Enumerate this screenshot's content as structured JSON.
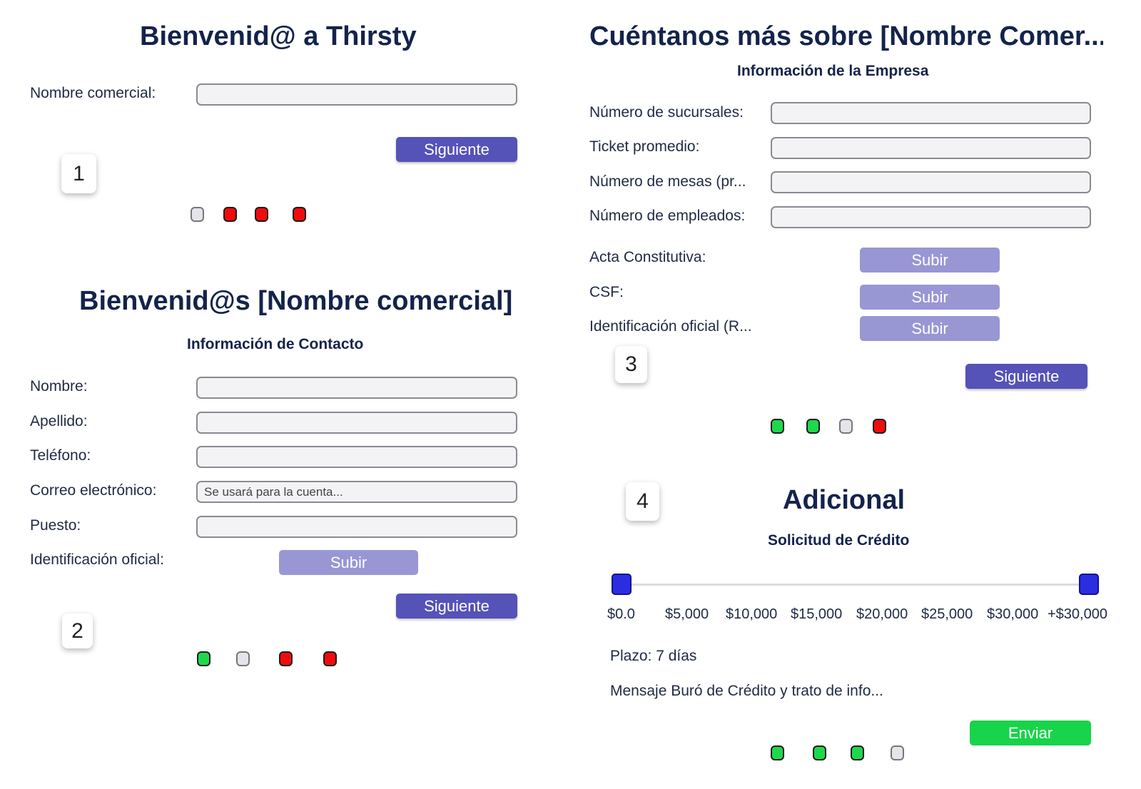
{
  "step1": {
    "title": "Bienvenid@ a Thirsty",
    "fields": [
      {
        "label": "Nombre comercial:",
        "value": "",
        "placeholder": ""
      }
    ],
    "next_label": "Siguiente",
    "step_number": "1",
    "progress": [
      "gray",
      "red",
      "red",
      "red"
    ]
  },
  "step2": {
    "title": "Bienvenid@s [Nombre comercial]",
    "subtitle": "Información de Contacto",
    "fields": [
      {
        "label": "Nombre:",
        "value": "",
        "placeholder": ""
      },
      {
        "label": "Apellido:",
        "value": "",
        "placeholder": ""
      },
      {
        "label": "Teléfono:",
        "value": "",
        "placeholder": ""
      },
      {
        "label": "Correo electrónico:",
        "value": "",
        "placeholder": "Se usará para la cuenta..."
      },
      {
        "label": "Puesto:",
        "value": "",
        "placeholder": ""
      }
    ],
    "upload": {
      "label": "Identificación oficial:",
      "button": "Subir"
    },
    "next_label": "Siguiente",
    "step_number": "2",
    "progress": [
      "green",
      "gray",
      "red",
      "red"
    ]
  },
  "step3": {
    "title": "Cuéntanos más sobre [Nombre Comer...",
    "subtitle": "Información de la Empresa",
    "fields": [
      {
        "label": "Número de sucursales:",
        "value": "",
        "placeholder": ""
      },
      {
        "label": "Ticket promedio:",
        "value": "",
        "placeholder": ""
      },
      {
        "label": "Número de mesas (pr...",
        "value": "",
        "placeholder": ""
      },
      {
        "label": "Número de empleados:",
        "value": "",
        "placeholder": ""
      }
    ],
    "uploads": [
      {
        "label": "Acta Constitutiva:",
        "button": "Subir"
      },
      {
        "label": "CSF:",
        "button": "Subir"
      },
      {
        "label": "Identificación oficial (R...",
        "button": "Subir"
      }
    ],
    "next_label": "Siguiente",
    "step_number": "3",
    "progress": [
      "green",
      "green",
      "gray",
      "red"
    ]
  },
  "step4": {
    "title": "Adicional",
    "subtitle": "Solicitud de Crédito",
    "step_number": "4",
    "slider": {
      "ticks": [
        "$0.0",
        "$5,000",
        "$10,000",
        "$15,000",
        "$20,000",
        "$25,000",
        "$30,000",
        "+$30,000"
      ],
      "low_value": "$0.0",
      "high_value": "+$30,000"
    },
    "plazo": "Plazo: 7 días",
    "message": "Mensaje Buró de Crédito y trato de info...",
    "send_label": "Enviar",
    "progress": [
      "green",
      "green",
      "green",
      "gray"
    ]
  },
  "colors": {
    "primary": "#5552b8",
    "upload": "#9996d4",
    "send": "#17d44a",
    "title": "#14234b",
    "dot_red": "#f00c0c",
    "dot_green": "#1ed84c",
    "dot_gray": "#e4e4ea",
    "slider_thumb": "#2b2ee0"
  }
}
